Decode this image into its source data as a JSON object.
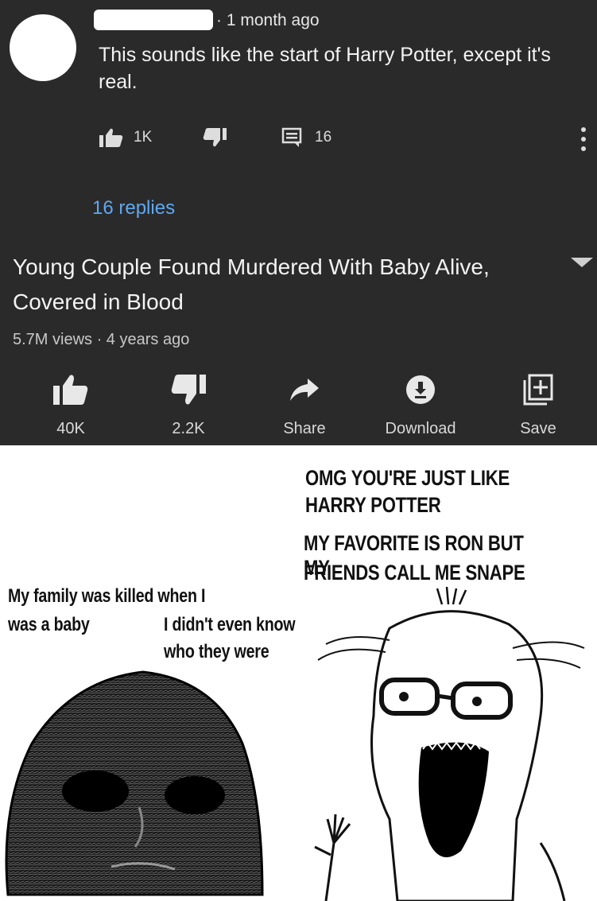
{
  "comment": {
    "time": "1 month ago",
    "text": "This sounds like the start of Harry Potter, except it's real.",
    "likes": "1K",
    "reply_count": "16",
    "replies_link": "16 replies"
  },
  "video": {
    "title": "Young Couple Found Murdered With Baby Alive, Covered in Blood",
    "meta": "5.7M views · 4 years ago",
    "actions": [
      {
        "label": "40K",
        "icon": "thumbs-up-icon"
      },
      {
        "label": "2.2K",
        "icon": "thumbs-down-icon"
      },
      {
        "label": "Share",
        "icon": "share-icon"
      },
      {
        "label": "Download",
        "icon": "download-icon"
      },
      {
        "label": "Save",
        "icon": "save-to-playlist-icon"
      }
    ]
  },
  "meme": {
    "wojak_line1": "My family was killed when I",
    "wojak_line2": "was a baby",
    "wojak_line3": "I didn't even know",
    "wojak_line4": "who they were",
    "soy_line1": "OMG YOU'RE JUST LIKE",
    "soy_line2": "HARRY POTTER",
    "soy_line3": "MY FAVORITE IS RON BUT MY",
    "soy_line4": "FRIENDS CALL ME SNAPE"
  },
  "colors": {
    "dark_bg": "#2a2a2a",
    "link_blue": "#5fa8f0"
  }
}
